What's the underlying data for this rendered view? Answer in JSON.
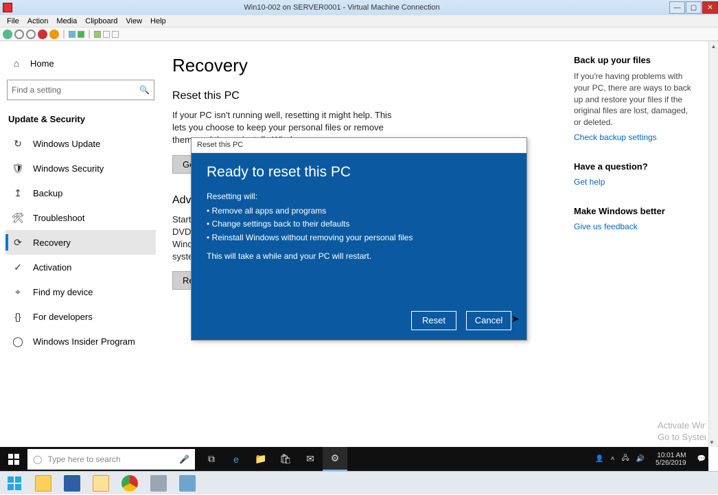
{
  "vm": {
    "title": "Win10-002 on SERVER0001 - Virtual Machine Connection",
    "menus": [
      "File",
      "Action",
      "Media",
      "Clipboard",
      "View",
      "Help"
    ]
  },
  "sidebar": {
    "home": "Home",
    "search_placeholder": "Find a setting",
    "category": "Update & Security",
    "items": [
      {
        "icon": "↻",
        "label": "Windows Update"
      },
      {
        "icon": "🛡",
        "label": "Windows Security"
      },
      {
        "icon": "↥",
        "label": "Backup"
      },
      {
        "icon": "🛠",
        "label": "Troubleshoot"
      },
      {
        "icon": "⟳",
        "label": "Recovery"
      },
      {
        "icon": "✓",
        "label": "Activation"
      },
      {
        "icon": "⌖",
        "label": "Find my device"
      },
      {
        "icon": "{}",
        "label": "For developers"
      },
      {
        "icon": "◯",
        "label": "Windows Insider Program"
      }
    ]
  },
  "main": {
    "title": "Recovery",
    "reset_h": "Reset this PC",
    "reset_body": "If your PC isn't running well, resetting it might help. This lets you choose to keep your personal files or remove them, and then reinstalls Windows.",
    "reset_btn": "Get started",
    "adv_h": "Advanced startup",
    "adv_body": "Start up from a device or disc (such as a USB drive or DVD), change your PC's firmware settings, change Windows startup settings, or restore Windows from a system image. This will restart your PC.",
    "adv_btn": "Restart now"
  },
  "right": {
    "h1": "Back up your files",
    "p1": "If you're having problems with your PC, there are ways to back up and restore your files if the original files are lost, damaged, or deleted.",
    "l1": "Check backup settings",
    "h2": "Have a question?",
    "l2": "Get help",
    "h3": "Make Windows better",
    "l3": "Give us feedback"
  },
  "dialog": {
    "frame_title": "Reset this PC",
    "heading": "Ready to reset this PC",
    "intro": "Resetting will:",
    "bullets": [
      "Remove all apps and programs",
      "Change settings back to their defaults",
      "Reinstall Windows without removing your personal files"
    ],
    "note": "This will take a while and your PC will restart.",
    "reset": "Reset",
    "cancel": "Cancel"
  },
  "watermark": {
    "l1": "Activate Windows",
    "l2": "Go to System in Control Panel to activate Windows."
  },
  "guest_taskbar": {
    "search": "Type here to search",
    "time": "10:01 AM",
    "date": "5/26/2019"
  }
}
